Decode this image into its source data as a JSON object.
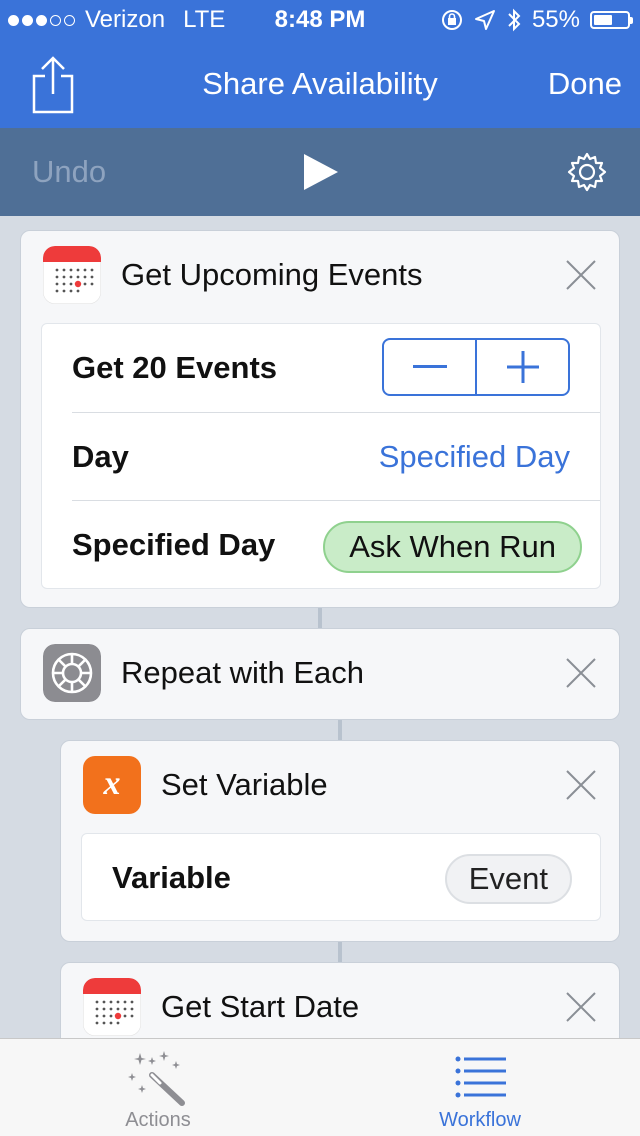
{
  "status_bar": {
    "carrier": "Verizon",
    "network": "LTE",
    "time": "8:48 PM",
    "battery": "55%",
    "battery_level": 0.55,
    "signal_bars_filled": 3,
    "signal_bars_total": 5
  },
  "nav": {
    "title": "Share Availability",
    "done_label": "Done",
    "share_icon": "share-icon"
  },
  "toolbar": {
    "undo_label": "Undo",
    "play_icon": "play-icon",
    "settings_icon": "gear-icon"
  },
  "actions": [
    {
      "title": "Get Upcoming Events",
      "icon": "calendar-icon",
      "params": {
        "count_label": "Get 20 Events",
        "day_label": "Day",
        "day_value": "Specified Day",
        "specified_day_label": "Specified Day",
        "specified_day_value": "Ask When Run"
      }
    },
    {
      "title": "Repeat with Each",
      "icon": "settings-icon"
    },
    {
      "title": "Set Variable",
      "icon": "variable-icon",
      "icon_glyph": "x",
      "params": {
        "variable_label": "Variable",
        "variable_value": "Event"
      }
    },
    {
      "title": "Get Start Date",
      "icon": "calendar-icon"
    }
  ],
  "tabbar": {
    "actions_label": "Actions",
    "workflow_label": "Workflow",
    "active_tab": "Workflow"
  },
  "colors": {
    "accent": "#3a73d9",
    "toolbar": "#4f6f96",
    "ask_when_run_bg": "#c9ecc8",
    "variable_orange": "#f2711c",
    "calendar_red": "#ee3b3b",
    "inactive_tab": "#8e8e93"
  }
}
